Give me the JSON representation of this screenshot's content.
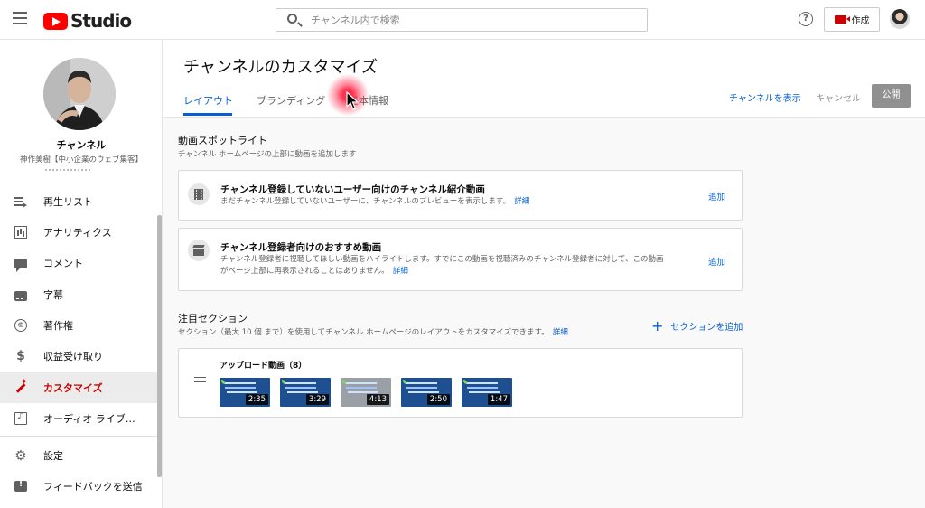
{
  "topbar": {
    "logo_text": "Studio",
    "search_placeholder": "チャンネル内で検索",
    "help_glyph": "?",
    "create_label": "作成"
  },
  "sidebar": {
    "channel_title": "チャンネル",
    "channel_subtitle": "神作美樹【中小企業のウェブ集客】",
    "items": [
      {
        "label": "再生リスト",
        "icon": "playlist-icon"
      },
      {
        "label": "アナリティクス",
        "icon": "analytics-icon"
      },
      {
        "label": "コメント",
        "icon": "comment-icon"
      },
      {
        "label": "字幕",
        "icon": "subtitles-icon"
      },
      {
        "label": "著作権",
        "icon": "copyright-icon"
      },
      {
        "label": "収益受け取り",
        "icon": "dollar-icon"
      },
      {
        "label": "カスタマイズ",
        "icon": "magic-wand-icon",
        "active": true
      },
      {
        "label": "オーディオ ライブ…",
        "icon": "audio-library-icon"
      },
      {
        "label": "設定",
        "icon": "gear-icon"
      },
      {
        "label": "フィードバックを送信",
        "icon": "feedback-icon"
      }
    ],
    "copyright_glyph": "©",
    "dollar_glyph": "$",
    "gear_glyph": "⚙"
  },
  "header": {
    "title": "チャンネルのカスタマイズ",
    "tabs": [
      {
        "label": "レイアウト",
        "active": true
      },
      {
        "label": "ブランディング",
        "active": false
      },
      {
        "label": "基本情報",
        "active": false
      }
    ],
    "view_channel": "チャンネルを表示",
    "cancel": "キャンセル",
    "publish": "公開"
  },
  "spotlight": {
    "title": "動画スポットライト",
    "description": "チャンネル ホームページの上部に動画を追加します",
    "cards": [
      {
        "title": "チャンネル登録していないユーザー向けのチャンネル紹介動画",
        "description": "まだチャンネル登録していないユーザーに、チャンネルのプレビューを表示します。",
        "link": "詳細",
        "add": "追加"
      },
      {
        "title": "チャンネル登録者向けのおすすめ動画",
        "description_line1": "チャンネル登録者に視聴してほしい動画をハイライトします。すでにこの動画を視聴済みのチャンネル登録者に対して、この動画",
        "description_line2": "がページ上部に再表示されることはありません。",
        "link": "詳細",
        "add": "追加"
      }
    ]
  },
  "featured": {
    "title": "注目セクション",
    "description": "セクション（最大 10 個 まで）を使用してチャンネル ホームページのレイアウトをカスタマイズできます。",
    "link": "詳細",
    "add_section": "セクションを追加",
    "shelf_title": "アップロード動画（8）",
    "videos": [
      {
        "duration": "2:35"
      },
      {
        "duration": "3:29"
      },
      {
        "duration": "4:13"
      },
      {
        "duration": "2:50"
      },
      {
        "duration": "1:47"
      }
    ]
  },
  "colors": {
    "accent_blue": "#065fd4",
    "brand_red": "#ff0000",
    "active_red": "#cc0000",
    "publish_gray": "#909090"
  }
}
